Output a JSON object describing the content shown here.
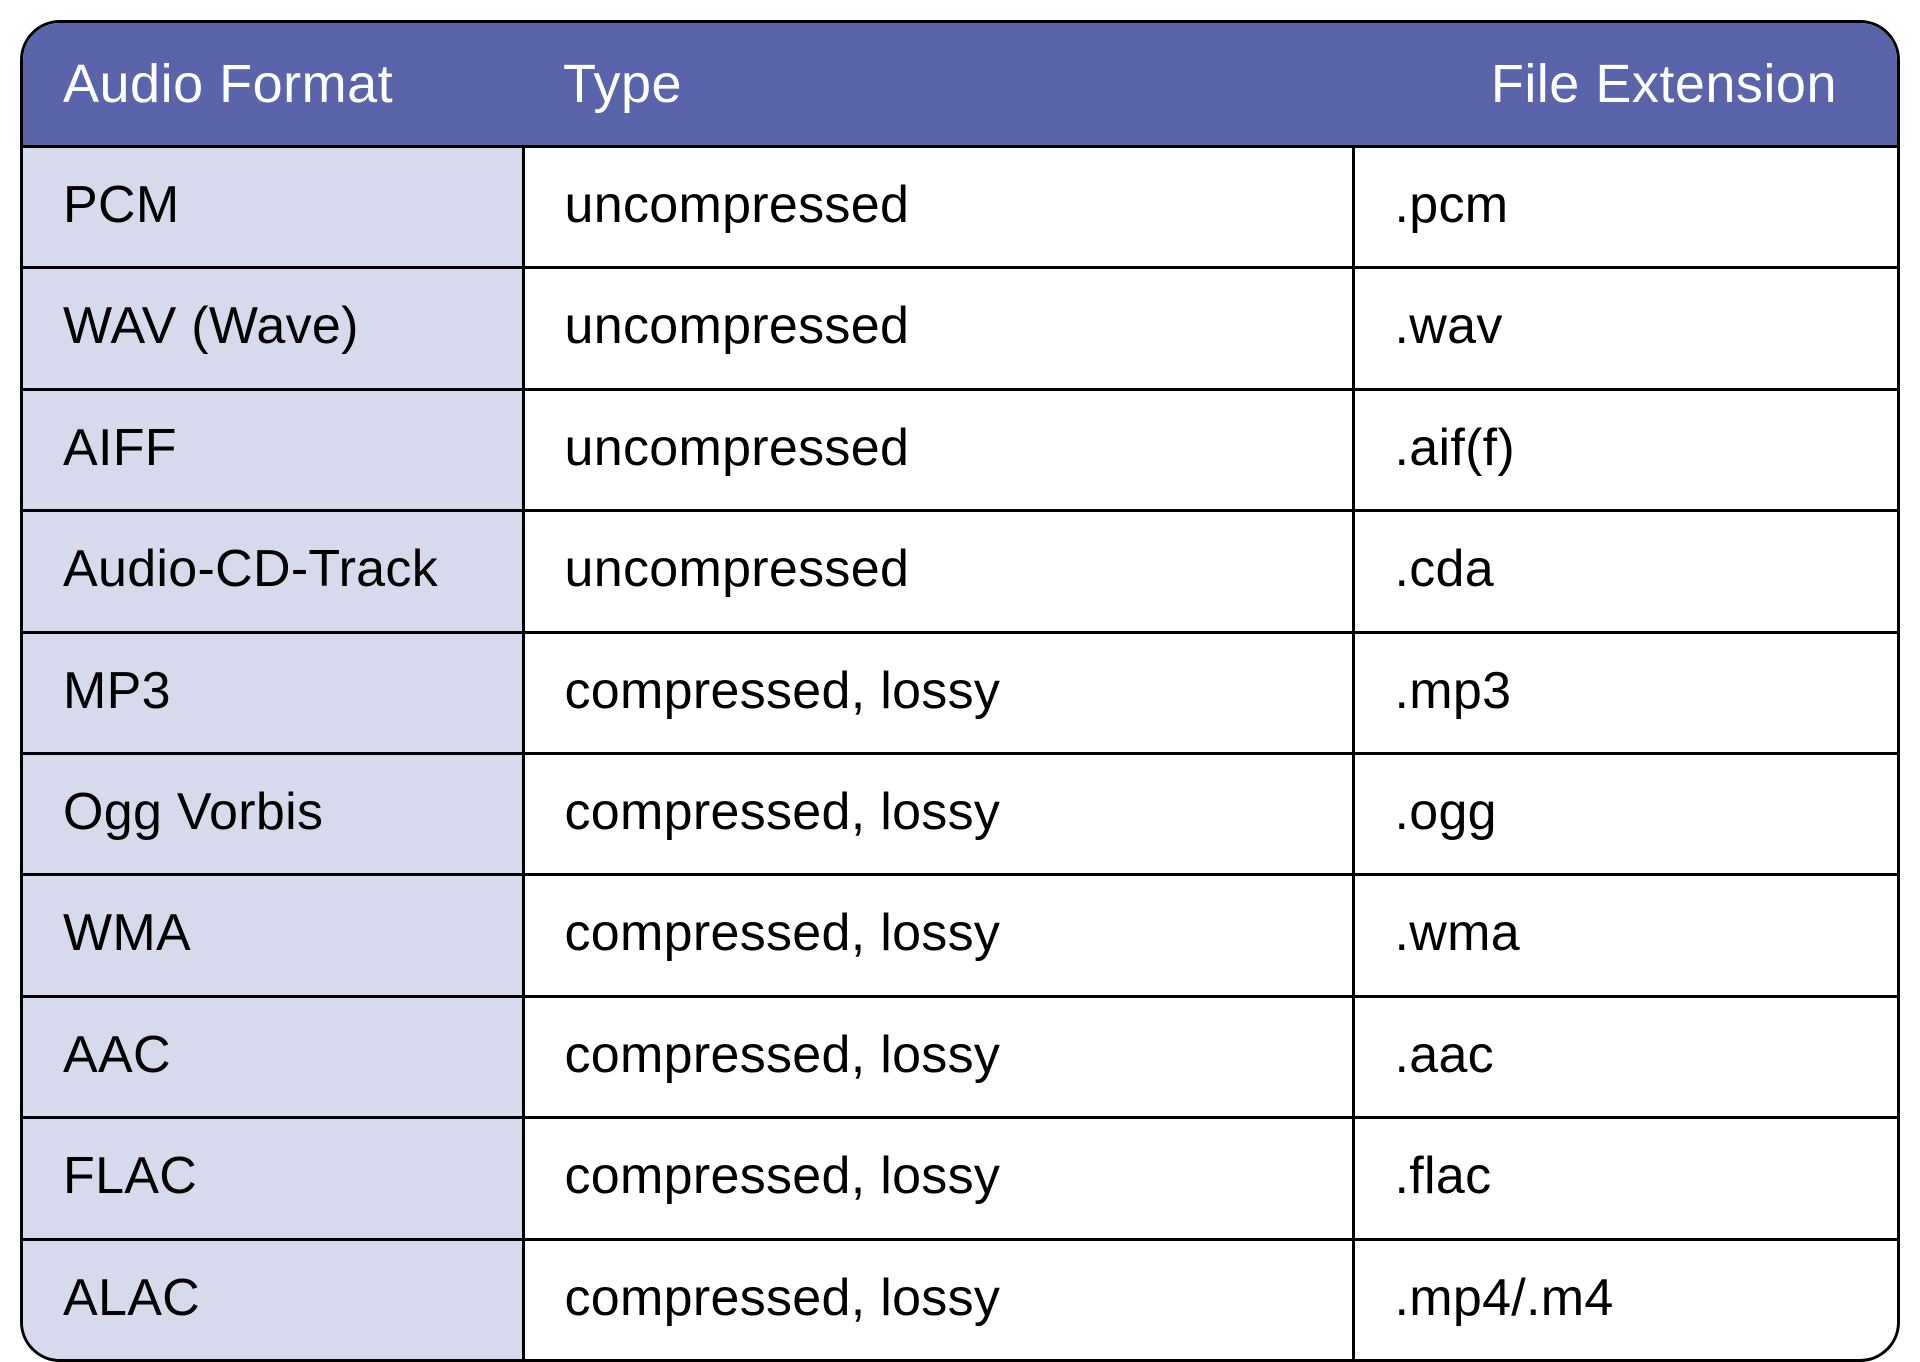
{
  "chart_data": {
    "type": "table",
    "columns": [
      "Audio Format",
      "Type",
      "File Extension"
    ],
    "rows": [
      [
        "PCM",
        "uncompressed",
        ".pcm"
      ],
      [
        "WAV (Wave)",
        "uncompressed",
        ".wav"
      ],
      [
        "AIFF",
        "uncompressed",
        ".aif(f)"
      ],
      [
        "Audio-CD-Track",
        "uncompressed",
        ".cda"
      ],
      [
        "MP3",
        "compressed, lossy",
        ".mp3"
      ],
      [
        "Ogg Vorbis",
        "compressed, lossy",
        ".ogg"
      ],
      [
        "WMA",
        "compressed, lossy",
        ".wma"
      ],
      [
        "AAC",
        "compressed, lossy",
        ".aac"
      ],
      [
        "FLAC",
        "compressed, lossy",
        ".flac"
      ],
      [
        "ALAC",
        "compressed, lossy",
        ".mp4/.m4"
      ]
    ]
  },
  "table": {
    "headers": {
      "format": "Audio Format",
      "type": "Type",
      "ext": "File Extension"
    },
    "rows": [
      {
        "format": "PCM",
        "type": "uncompressed",
        "ext": ".pcm"
      },
      {
        "format": "WAV (Wave)",
        "type": "uncompressed",
        "ext": ".wav"
      },
      {
        "format": "AIFF",
        "type": "uncompressed",
        "ext": ".aif(f)"
      },
      {
        "format": "Audio-CD-Track",
        "type": "uncompressed",
        "ext": ".cda"
      },
      {
        "format": "MP3",
        "type": "compressed, lossy",
        "ext": ".mp3"
      },
      {
        "format": "Ogg Vorbis",
        "type": "compressed, lossy",
        "ext": ".ogg"
      },
      {
        "format": "WMA",
        "type": "compressed, lossy",
        "ext": ".wma"
      },
      {
        "format": "AAC",
        "type": "compressed, lossy",
        "ext": ".aac"
      },
      {
        "format": "FLAC",
        "type": "compressed, lossy",
        "ext": ".flac"
      },
      {
        "format": "ALAC",
        "type": "compressed, lossy",
        "ext": ".mp4/.m4"
      }
    ]
  }
}
